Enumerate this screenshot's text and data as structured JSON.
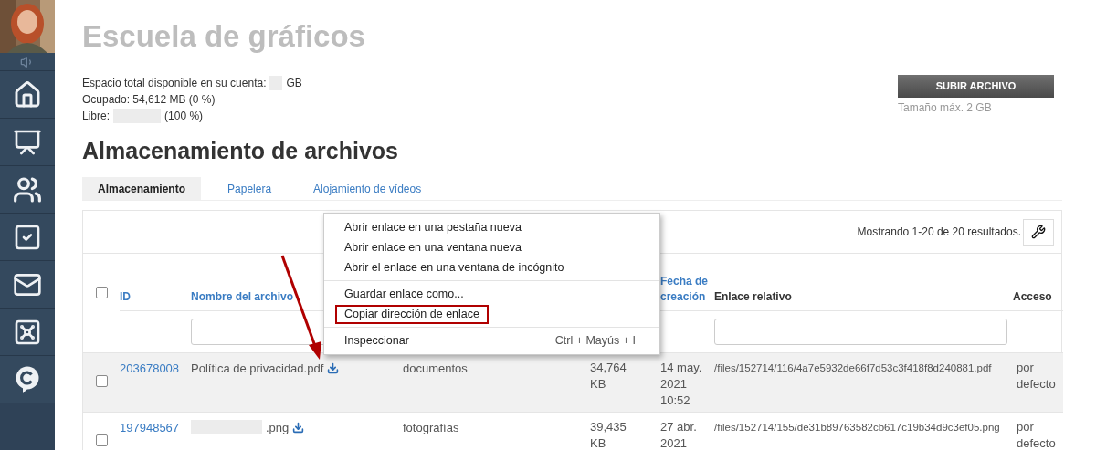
{
  "sidebar": {
    "items": [
      {
        "kind": "speaker",
        "selected": false
      },
      {
        "kind": "home",
        "selected": false
      },
      {
        "kind": "chart",
        "selected": false
      },
      {
        "kind": "people",
        "selected": false
      },
      {
        "kind": "tasks",
        "selected": false
      },
      {
        "kind": "mail",
        "selected": false
      },
      {
        "kind": "safe",
        "selected": false
      },
      {
        "kind": "chat",
        "selected": false
      }
    ]
  },
  "title": "Escuela de gráficos",
  "storage_info": [
    [
      {
        "kind": "text",
        "text": "Espacio total disponible en su cuenta:"
      },
      {
        "kind": "blur"
      },
      {
        "kind": "text",
        "text": "GB"
      }
    ],
    [
      {
        "kind": "text",
        "text": "Ocupado: 54,612 MB (0 %)"
      }
    ],
    [
      {
        "kind": "text",
        "text": "Libre:"
      },
      {
        "kind": "blur"
      },
      {
        "kind": "text",
        "text": "(100 %)"
      }
    ]
  ],
  "upload": {
    "button": "SUBIR ARCHIVO",
    "note": "Tamaño máx. 2 GB"
  },
  "heading": "Almacenamiento de archivos",
  "tabs": [
    {
      "label": "Almacenamiento",
      "selected": true
    },
    {
      "label": "Papelera",
      "selected": false
    },
    {
      "label": "Alojamiento de vídeos",
      "selected": false
    }
  ],
  "table": {
    "summary": "Mostrando 1-20 de 20 resultados.",
    "header_checked": false,
    "columns": [
      {
        "label": "ID",
        "sortable": true
      },
      {
        "label": "Nombre del archivo",
        "sortable": true
      },
      {},
      {},
      {
        "label": "Fecha de creación",
        "sortable": true
      },
      {
        "label": "Enlace relativo",
        "sortable": false
      },
      {
        "label": "Acceso",
        "sortable": false
      }
    ],
    "filter_row": [
      {
        "kind": "none"
      },
      {
        "kind": "input"
      },
      {
        "kind": "none"
      },
      {
        "kind": "none"
      },
      {
        "kind": "none"
      },
      {
        "kind": "input"
      },
      {
        "kind": "none"
      }
    ],
    "rows": [
      {
        "checked": false,
        "highlighted": true,
        "id": "203678008",
        "name": "Política de privacidad.pdf",
        "name_redacted": false,
        "folder": "documentos",
        "size": [
          "34,764",
          "KB"
        ],
        "date": [
          "14 may.",
          "2021",
          "10:52"
        ],
        "link": "/files/152714/116/4a7e5932de66f7d53c3f418f8d240881.pdf",
        "access": "por defecto"
      },
      {
        "checked": false,
        "highlighted": false,
        "id": "197948567",
        "name": ".png",
        "name_redacted": true,
        "folder": "fotografías",
        "size": [
          "39,435",
          "KB"
        ],
        "date": [
          "27 abr.",
          "2021"
        ],
        "link": "/files/152714/155/de31b89763582cb617c19b34d9c3ef05.png",
        "access": "por defecto"
      }
    ]
  },
  "context_menu": {
    "items": [
      {
        "kind": "item",
        "label": "Abrir enlace en una pestaña nueva",
        "annotated": false
      },
      {
        "kind": "item",
        "label": "Abrir enlace en una ventana nueva",
        "annotated": false
      },
      {
        "kind": "item",
        "label": "Abrir el enlace en una ventana de incógnito",
        "annotated": false
      },
      {
        "kind": "separator"
      },
      {
        "kind": "item",
        "label": "Guardar enlace como...",
        "annotated": false
      },
      {
        "kind": "item",
        "label": "Copiar dirección de enlace",
        "annotated": true
      },
      {
        "kind": "separator"
      },
      {
        "kind": "item",
        "label": "Inspeccionar",
        "shortcut": "Ctrl + Mayús + I",
        "annotated": false
      }
    ]
  },
  "annotation": {
    "kind": "arrow"
  }
}
